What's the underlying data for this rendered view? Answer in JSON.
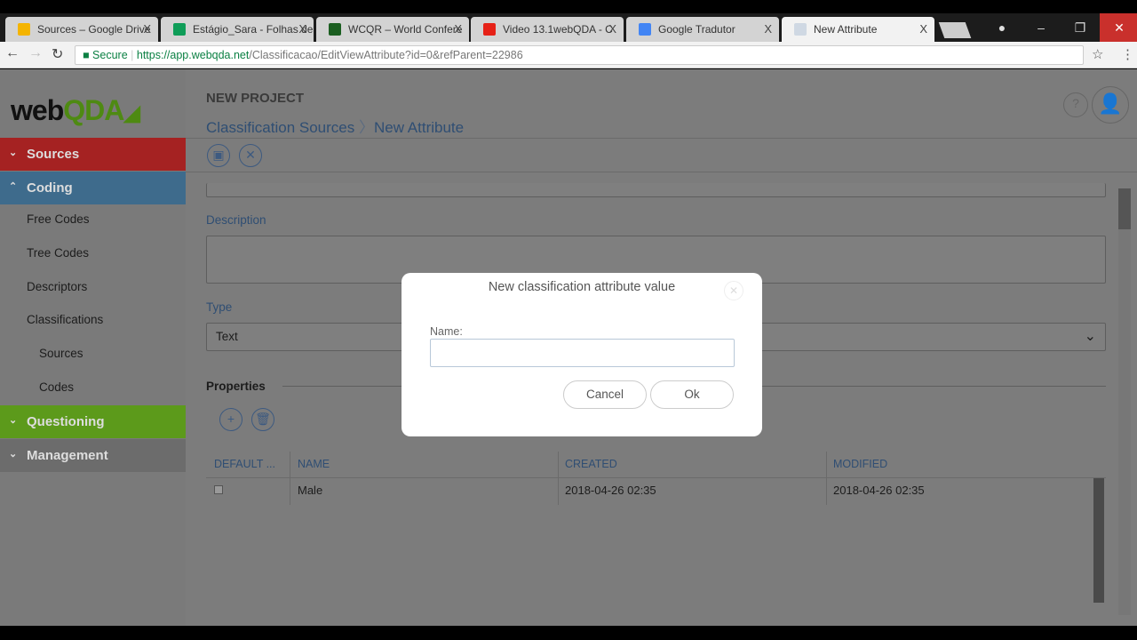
{
  "browser": {
    "tabs": [
      {
        "title": "Sources – Google Drive",
        "color": "#f4b400"
      },
      {
        "title": "Estágio_Sara - Folhas de",
        "color": "#0f9d58"
      },
      {
        "title": "WCQR – World Confere",
        "color": "#1b5e20"
      },
      {
        "title": "Video 13.1webQDA - C",
        "color": "#e62117"
      },
      {
        "title": "Google Tradutor",
        "color": "#4285f4"
      },
      {
        "title": "New Attribute",
        "color": "#cfd8e3"
      }
    ],
    "close": "X",
    "secure": "Secure",
    "url_host": "https://app.webqda.net",
    "url_path": "/Classificacao/EditViewAttribute?id=0&refParent=22986"
  },
  "logo": {
    "text_a": "web",
    "text_b": "QDA"
  },
  "header": {
    "project": "NEW PROJECT",
    "crumb1": "Classification Sources",
    "crumb2": "New Attribute"
  },
  "sidebar": {
    "sections": [
      {
        "label": "Sources",
        "color": "#a52222"
      },
      {
        "label": "Coding",
        "color": "#3e6b8c"
      },
      {
        "label": "Questioning",
        "color": "#5c9a1b"
      },
      {
        "label": "Management",
        "color": "#6c6c6c"
      }
    ],
    "items": [
      "Free Codes",
      "Tree Codes",
      "Descriptors",
      "Classifications",
      "Sources",
      "Codes"
    ]
  },
  "form": {
    "description_label": "Description",
    "type_label": "Type",
    "type_value": "Text",
    "properties_label": "Properties"
  },
  "table": {
    "headers": [
      "DEFAULT ...",
      "NAME",
      "CREATED",
      "MODIFIED"
    ],
    "rows": [
      {
        "default": false,
        "name": "Male",
        "created": "2018-04-26 02:35",
        "modified": "2018-04-26 02:35"
      }
    ]
  },
  "modal": {
    "title": "New classification attribute value",
    "name_label": "Name:",
    "name_value": "",
    "cancel": "Cancel",
    "ok": "Ok"
  }
}
